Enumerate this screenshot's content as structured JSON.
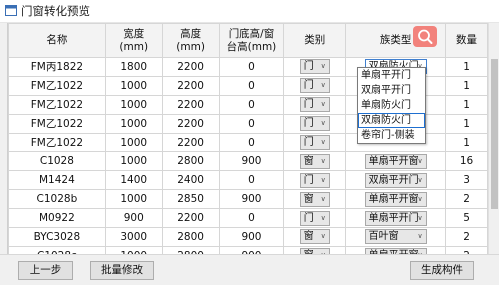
{
  "window": {
    "title": "门窗转化预览",
    "icon": "app-window-icon"
  },
  "table": {
    "headers": [
      "名称",
      "宽度\n(mm)",
      "高度\n(mm)",
      "门底高/窗\n台高(mm)",
      "类别",
      "族类型",
      "数量"
    ],
    "rows": [
      {
        "name": "FM丙1822",
        "width": "1800",
        "height": "2200",
        "sill": "0",
        "category": "门",
        "family": "双扇防火门",
        "count": "1"
      },
      {
        "name": "FM乙1022",
        "width": "1000",
        "height": "2200",
        "sill": "0",
        "category": "门",
        "family": "",
        "count": "1"
      },
      {
        "name": "FM乙1022",
        "width": "1000",
        "height": "2200",
        "sill": "0",
        "category": "门",
        "family": "",
        "count": "1"
      },
      {
        "name": "FM乙1022",
        "width": "1000",
        "height": "2200",
        "sill": "0",
        "category": "门",
        "family": "",
        "count": "1"
      },
      {
        "name": "FM乙1022",
        "width": "1000",
        "height": "2200",
        "sill": "0",
        "category": "门",
        "family": "",
        "count": "1"
      },
      {
        "name": "C1028",
        "width": "1000",
        "height": "2800",
        "sill": "900",
        "category": "窗",
        "family": "单扇平开窗",
        "count": "16"
      },
      {
        "name": "M1424",
        "width": "1400",
        "height": "2400",
        "sill": "0",
        "category": "门",
        "family": "双扇平开门",
        "count": "3"
      },
      {
        "name": "C1028b",
        "width": "1000",
        "height": "2850",
        "sill": "900",
        "category": "窗",
        "family": "单扇平开窗",
        "count": "2"
      },
      {
        "name": "M0922",
        "width": "900",
        "height": "2200",
        "sill": "0",
        "category": "门",
        "family": "单扇平开门",
        "count": "5"
      },
      {
        "name": "BYC3028",
        "width": "3000",
        "height": "2800",
        "sill": "900",
        "category": "窗",
        "family": "百叶窗",
        "count": "2"
      },
      {
        "name": "C1028c",
        "width": "1000",
        "height": "2800",
        "sill": "900",
        "category": "窗",
        "family": "单扇平开窗",
        "count": "2"
      }
    ]
  },
  "family_dropdown": {
    "options": [
      "单扇平开门",
      "双扇平开门",
      "单扇防火门",
      "双扇防火门",
      "卷帘门-侧装"
    ],
    "selected_index": 3
  },
  "search_button": {
    "icon": "search-icon",
    "color": "#f2827c"
  },
  "buttons": {
    "prev": "上一步",
    "batch_edit": "批量修改",
    "generate": "生成构件"
  }
}
